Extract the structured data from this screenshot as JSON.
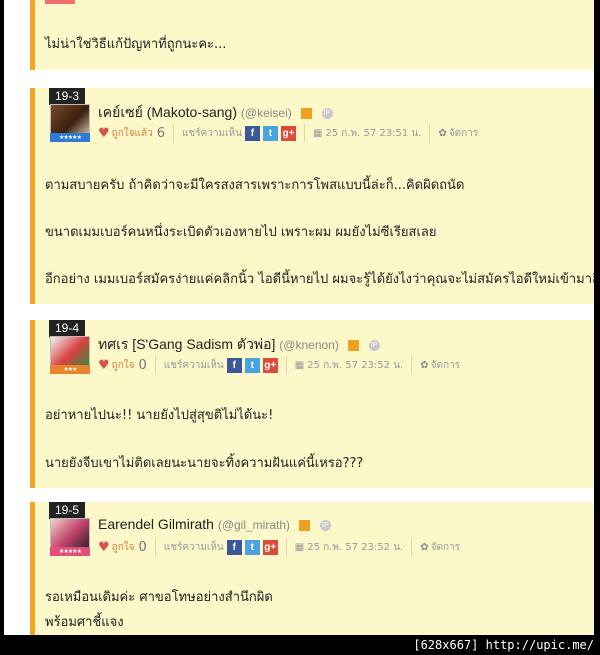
{
  "top_comment": {
    "text": "ไม่น่าใช่วิธีแก้ปัญหาที่ถูกนะคะ..."
  },
  "comments": [
    {
      "number": "19-3",
      "name": "เคย์เซย์ (Makoto-sang)",
      "handle": "(@keisei)",
      "rank_stars": "★★★★★",
      "like_label": "ถูกใจแล้ว",
      "like_count": "6",
      "share_label": "แชร์ความเห็น",
      "date": "25 ก.พ. 57 23:51 น.",
      "manage_label": "จัดการ",
      "paragraphs": [
        "ตามสบายครับ ถ้าคิดว่าจะมีใครสงสารเพราะการโพสแบบนี้ล่ะก็...คิดผิดถนัด",
        "ขนาดเมมเบอร์คนหนึ่งระเบิดตัวเองหายไป เพราะผม ผมยังไม่ซีเรียสเลย",
        "อีกอย่าง เมมเบอร์สมัครง่ายแค่คลิกนิ้ว ไอดีนี้หายไป ผมจะรู้ได้ยังไงว่าคุณจะไม่สมัครไอดีใหม่เข้ามาอีก?"
      ]
    },
    {
      "number": "19-4",
      "name": "ทศเร [S'Gang Sadism ตัวพ่อ]",
      "handle": "(@knenon)",
      "rank_stars": "★★★",
      "like_label": "ถูกใจ",
      "like_count": "0",
      "share_label": "แชร์ความเห็น",
      "date": "25 ก.พ. 57 23:52 น.",
      "manage_label": "จัดการ",
      "paragraphs": [
        "อย่าหายไปนะ!! นายยังไปสู่สุขติไม่ได้นะ!",
        "นายยังจีบเขาไม่ติดเลยนะนายจะทิ้งความฝันแค่นี้เหรอ???"
      ]
    },
    {
      "number": "19-5",
      "name": "Earendel Gilmirath",
      "handle": "(@gil_mirath)",
      "rank_stars": "★★★★★",
      "like_label": "ถูกใจ",
      "like_count": "0",
      "share_label": "แชร์ความเห็น",
      "date": "25 ก.พ. 57 23:52 น.",
      "manage_label": "จัดการ",
      "paragraphs": [
        "รอเหมือนเดิมค่ะ ศาขอโทษอย่างสำนึกผิด",
        "พร้อมศาชี้แจง"
      ]
    }
  ],
  "footer": {
    "size": "[628x667]",
    "url": "http://upic.me/"
  },
  "icons": {
    "share_fb": "f",
    "share_tw": "t",
    "share_gp": "g+",
    "ip": "IP"
  },
  "colors": {
    "card_bg": "#fdf8c9",
    "accent_border": "#f5a623",
    "rank_blue": "#2d7bd2",
    "rank_orange": "#e8842c",
    "rank_pink": "#e0507a"
  }
}
